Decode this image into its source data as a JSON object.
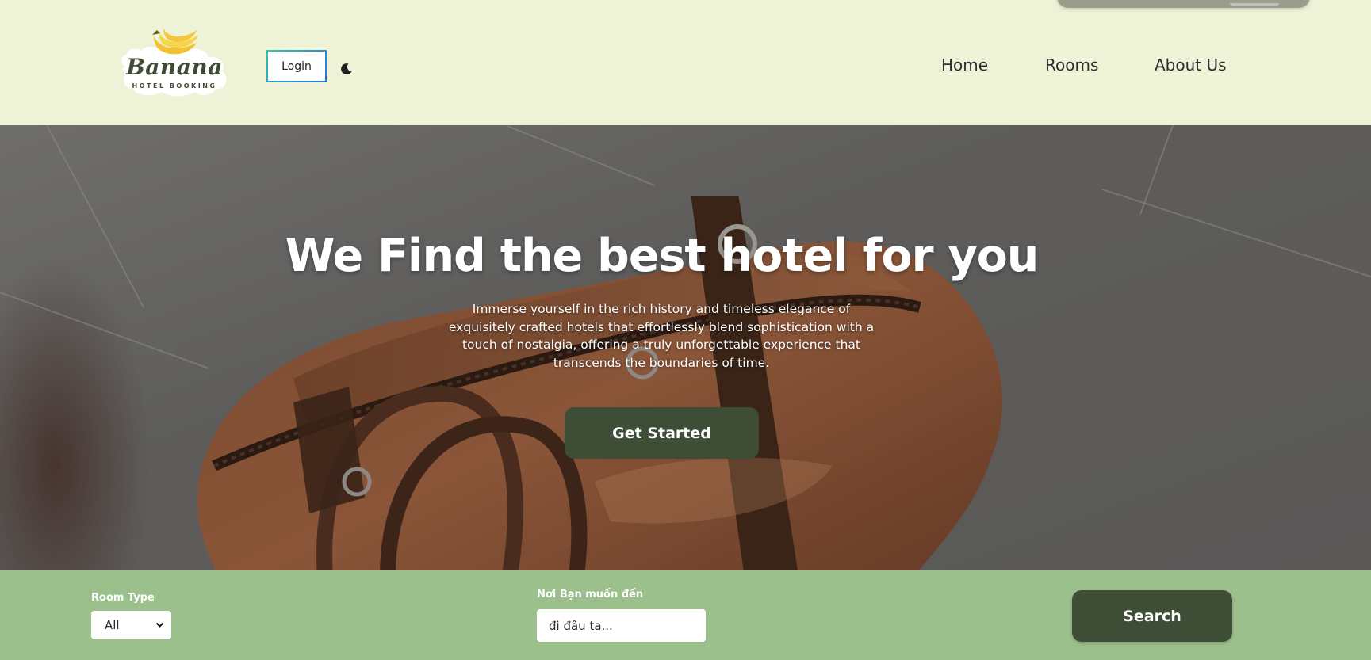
{
  "header": {
    "logo": {
      "script_text": "Banana",
      "subtitle": "HOTEL BOOKING"
    },
    "login_label": "Login",
    "theme_icon": "moon-icon",
    "nav": [
      {
        "label": "Home"
      },
      {
        "label": "Rooms"
      },
      {
        "label": "About Us"
      }
    ]
  },
  "hero": {
    "title": "We Find the best hotel for you",
    "description": "Immerse yourself in the rich history and timeless elegance of exquisitely crafted hotels that effortlessly blend sophistication with a touch of nostalgia, offering a truly unforgettable experience that transcends the boundaries of time.",
    "cta_label": "Get Started"
  },
  "search": {
    "room_type_label": "Room Type",
    "room_type_value": "All",
    "destination_label": "Nơi Bạn muốn đến",
    "destination_placeholder": "đi đâu ta...",
    "search_label": "Search"
  },
  "colors": {
    "header_bg": "#eef2d6",
    "dark_green": "#3e4d36",
    "search_bar_bg": "#9cc08b",
    "login_border_start": "#2ec4b0",
    "login_border_end": "#2a6fe0"
  }
}
